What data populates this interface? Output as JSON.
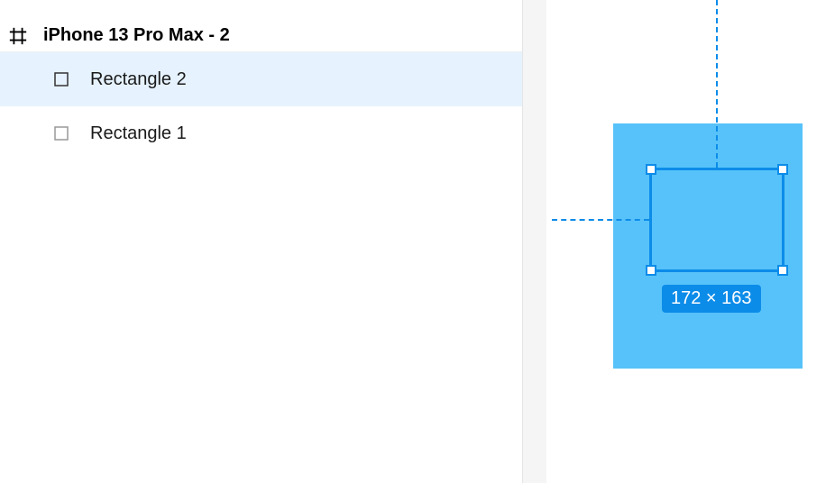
{
  "frame": {
    "label": "iPhone 13 Pro Max - 2"
  },
  "layers": {
    "items": [
      {
        "label": "Rectangle 2",
        "selected": true
      },
      {
        "label": "Rectangle 1",
        "selected": false
      }
    ]
  },
  "selection": {
    "size_label": "172 × 163"
  }
}
